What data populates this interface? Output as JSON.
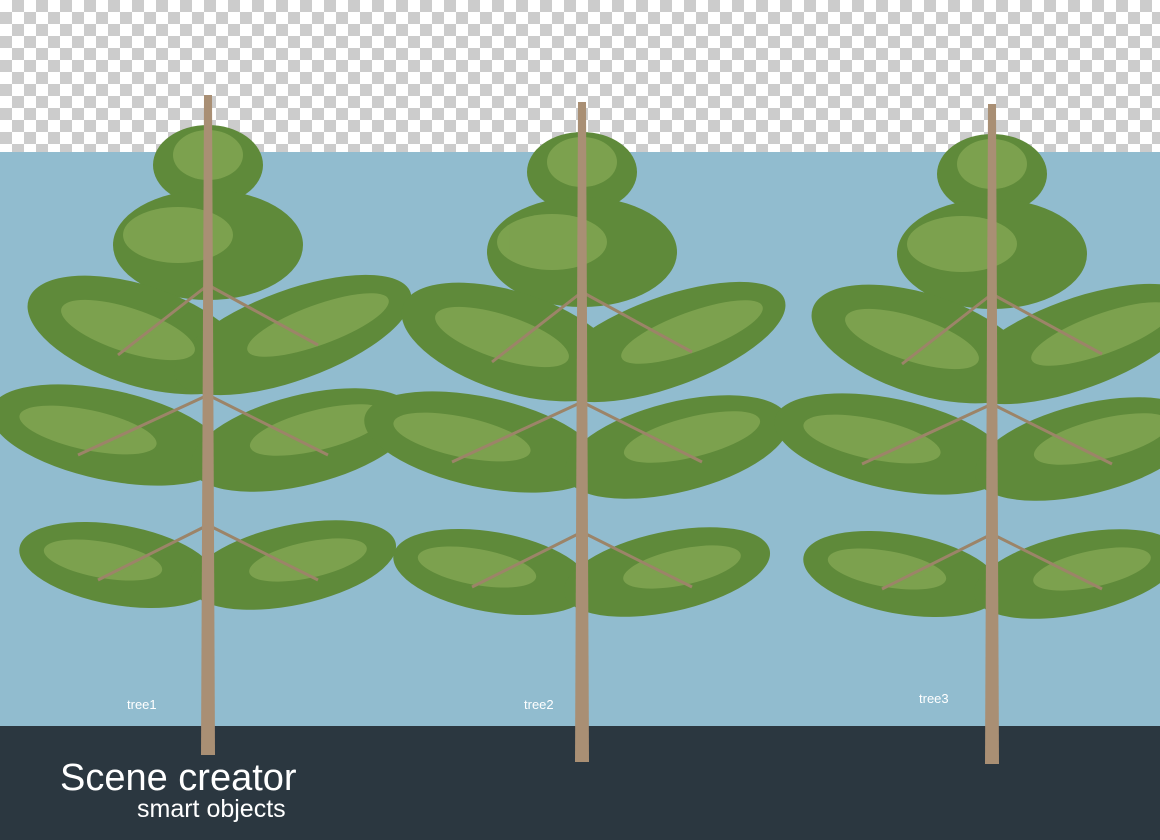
{
  "trees": [
    {
      "label": "tree1"
    },
    {
      "label": "tree2"
    },
    {
      "label": "tree3"
    }
  ],
  "caption": {
    "title": "Scene creator",
    "subtitle": "smart objects"
  },
  "colors": {
    "sky": "#91bccf",
    "ground": "#2b3740",
    "foliage": "#5f8a3a",
    "foliage_light": "#86a955",
    "trunk": "#a98f74"
  }
}
